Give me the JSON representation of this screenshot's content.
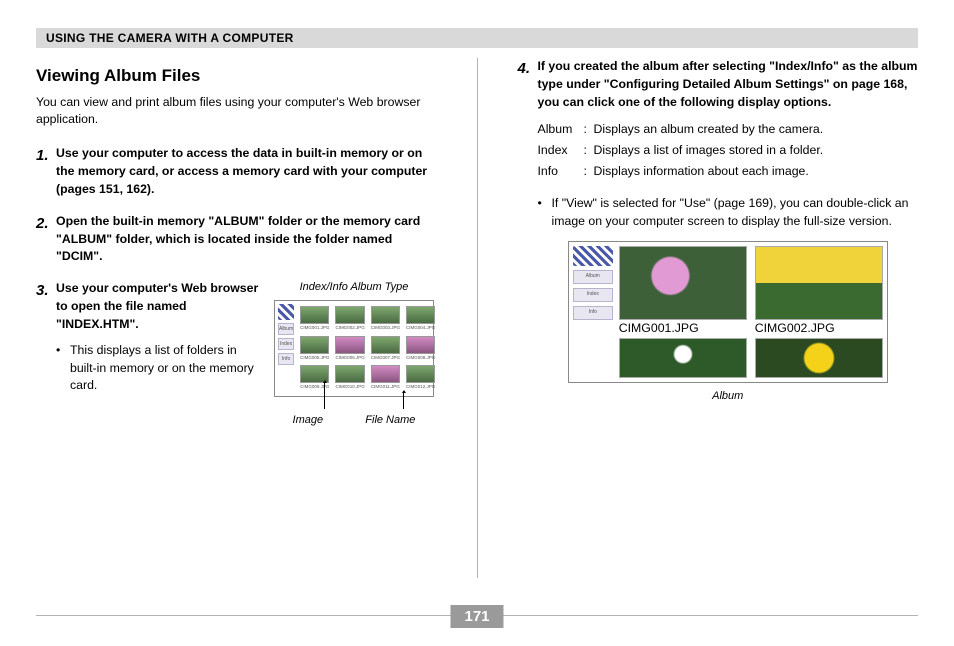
{
  "header": "USING THE CAMERA WITH A COMPUTER",
  "page_number": "171",
  "left": {
    "title": "Viewing Album Files",
    "intro": "You can view and print album files using your computer's Web browser application.",
    "step1_num": "1.",
    "step1_body": "Use your computer to access the data in built-in memory or on the memory card, or access a memory card with your computer (pages 151, 162).",
    "step2_num": "2.",
    "step2_body": "Open the built-in memory \"ALBUM\" folder or the memory card \"ALBUM\" folder, which is located inside the folder named \"DCIM\".",
    "step3_num": "3.",
    "step3_body": "Use your computer's Web browser to open the file named \"INDEX.HTM\".",
    "step3_bullet": "This displays a list of folders in built-in memory or on the memory card.",
    "fig1_caption_top": "Index/Info Album Type",
    "fig1_label_image": "Image",
    "fig1_label_filename": "File Name",
    "side_btn_album": "Album",
    "side_btn_index": "Index",
    "side_btn_info": "Info"
  },
  "right": {
    "step4_num": "4.",
    "step4_body": "If you created the album after selecting \"Index/Info\" as the album type under \"Configuring Detailed Album Settings\" on page 168, you can click one of the following display options.",
    "def": [
      {
        "key": "Album",
        "val": "Displays an album created by the camera."
      },
      {
        "key": "Index",
        "val": "Displays a list of images stored in a folder."
      },
      {
        "key": "Info",
        "val": "Displays information about each image."
      }
    ],
    "bullet": "If \"View\" is selected for \"Use\" (page 169), you can double-click an image on your computer screen to display the full-size version.",
    "fig2_caption": "Album"
  }
}
